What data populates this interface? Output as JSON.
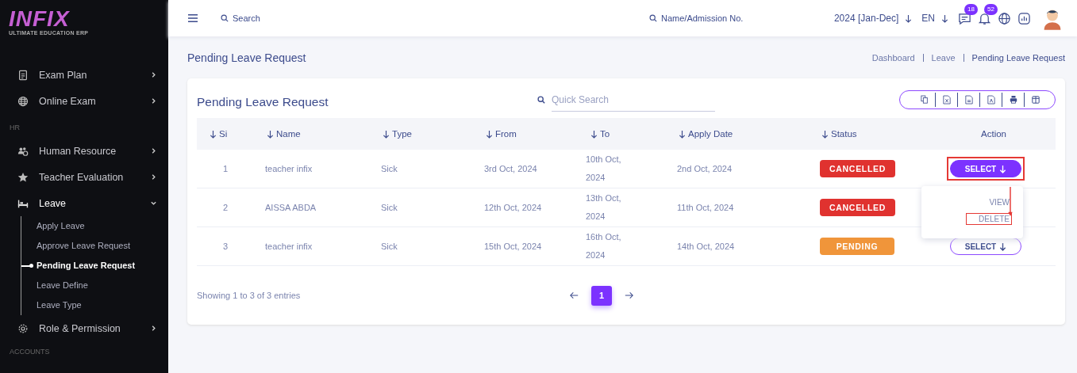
{
  "sidebar": {
    "logo": {
      "title": "INFIX",
      "subtitle": "ULTIMATE EDUCATION ERP"
    },
    "items": [
      {
        "kind": "item",
        "label": "Exam Plan",
        "expanded": false
      },
      {
        "kind": "item",
        "label": "Online Exam",
        "expanded": false
      },
      {
        "kind": "section",
        "label": "HR"
      },
      {
        "kind": "item",
        "label": "Human Resource",
        "expanded": false
      },
      {
        "kind": "item",
        "label": "Teacher Evaluation",
        "expanded": false
      },
      {
        "kind": "item",
        "label": "Leave",
        "expanded": true,
        "children": [
          {
            "label": "Apply Leave",
            "selected": false
          },
          {
            "label": "Approve Leave Request",
            "selected": false
          },
          {
            "label": "Pending Leave Request",
            "selected": true
          },
          {
            "label": "Leave Define",
            "selected": false
          },
          {
            "label": "Leave Type",
            "selected": false
          }
        ]
      },
      {
        "kind": "item",
        "label": "Role & Permission",
        "expanded": false
      },
      {
        "kind": "section",
        "label": "ACCOUNTS"
      }
    ]
  },
  "topbar": {
    "search": {
      "placeholder": "Search"
    },
    "student_search": {
      "placeholder": "Name/Admission No."
    },
    "year": "2024 [Jan-Dec]",
    "language": "EN",
    "messages_count": "18",
    "notifications_count": "52"
  },
  "page": {
    "title": "Pending Leave Request",
    "breadcrumb": [
      "Dashboard",
      "Leave",
      "Pending Leave Request"
    ]
  },
  "card": {
    "title": "Pending Leave Request",
    "quick_search": {
      "placeholder": "Quick Search"
    },
    "table": {
      "columns": [
        {
          "label": "Si",
          "sortable": true
        },
        {
          "label": "Name",
          "sortable": true
        },
        {
          "label": "Type",
          "sortable": true
        },
        {
          "label": "From",
          "sortable": true
        },
        {
          "label": "To",
          "sortable": true
        },
        {
          "label": "Apply Date",
          "sortable": true
        },
        {
          "label": "Status",
          "sortable": true
        },
        {
          "label": "Action",
          "sortable": false
        }
      ],
      "rows": [
        {
          "si": "1",
          "name": "teacher infix",
          "type": "Sick",
          "from": "3rd Oct, 2024",
          "to": "10th Oct, 2024",
          "apply_date": "2nd Oct, 2024",
          "status": {
            "label": "CANCELLED",
            "kind": "cancelled"
          },
          "action": {
            "label": "SELECT",
            "open": true,
            "highlighted": true,
            "menu": [
              {
                "label": "VIEW",
                "highlighted": false
              },
              {
                "label": "DELETE",
                "highlighted": true
              }
            ]
          }
        },
        {
          "si": "2",
          "name": "AISSA ABDA",
          "type": "Sick",
          "from": "12th Oct, 2024",
          "to": "13th Oct, 2024",
          "apply_date": "11th Oct, 2024",
          "status": {
            "label": "CANCELLED",
            "kind": "cancelled"
          }
        },
        {
          "si": "3",
          "name": "teacher infix",
          "type": "Sick",
          "from": "15th Oct, 2024",
          "to": "16th Oct, 2024",
          "apply_date": "14th Oct, 2024",
          "status": {
            "label": "PENDING",
            "kind": "pending"
          },
          "action": {
            "label": "SELECT",
            "open": false,
            "highlighted": false
          }
        }
      ]
    },
    "footer": {
      "info": "Showing 1 to 3 of 3 entries",
      "pages": [
        {
          "label": "1",
          "selected": true
        }
      ]
    }
  }
}
